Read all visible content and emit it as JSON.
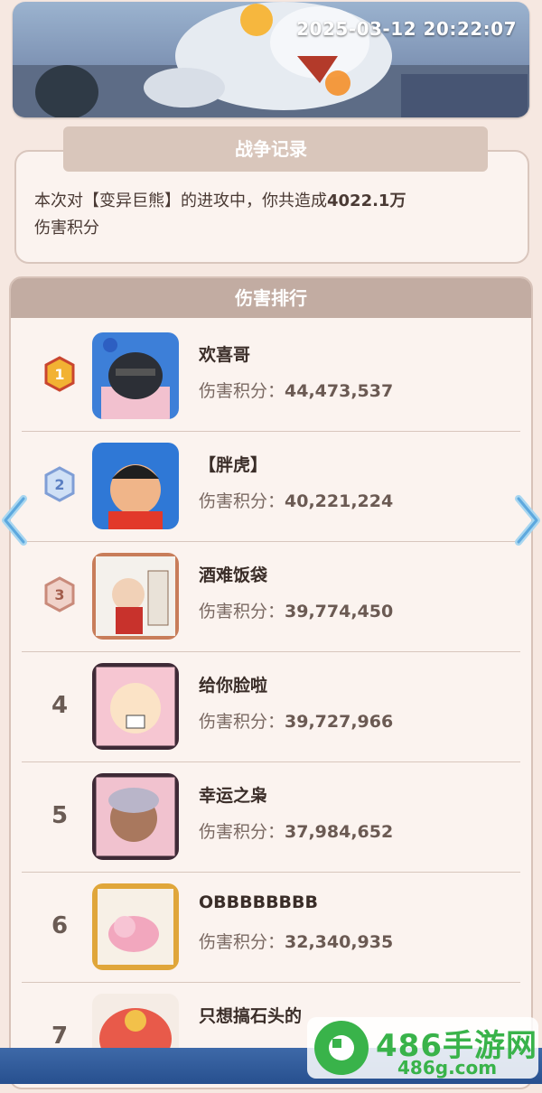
{
  "banner": {
    "timestamp": "2025-03-12 20:22:07"
  },
  "record": {
    "title": "战争记录",
    "text_before": "本次对【变异巨熊】的进攻中，你共造成",
    "amount": "4022.1万",
    "text_after": "伤害积分"
  },
  "ranking": {
    "title": "伤害排行",
    "score_label": "伤害积分：",
    "rows": [
      {
        "rank": "1",
        "name": "欢喜哥",
        "score": "44,473,537"
      },
      {
        "rank": "2",
        "name": "【胖虎】",
        "score": "40,221,224"
      },
      {
        "rank": "3",
        "name": "酒难饭袋",
        "score": "39,774,450"
      },
      {
        "rank": "4",
        "name": "给你脸啦",
        "score": "39,727,966"
      },
      {
        "rank": "5",
        "name": "幸运之枭",
        "score": "37,984,652"
      },
      {
        "rank": "6",
        "name": "OBBBBBBBB",
        "score": "32,340,935"
      },
      {
        "rank": "7",
        "name": "只想搞石头的",
        "score": ""
      }
    ]
  },
  "watermark": {
    "brand": "486手游网",
    "url": "486g.com"
  },
  "colors": {
    "gold": "#f2b233",
    "silver": "#7f9ed6",
    "bronze": "#c98a7a",
    "accent_green": "#39b34a"
  }
}
